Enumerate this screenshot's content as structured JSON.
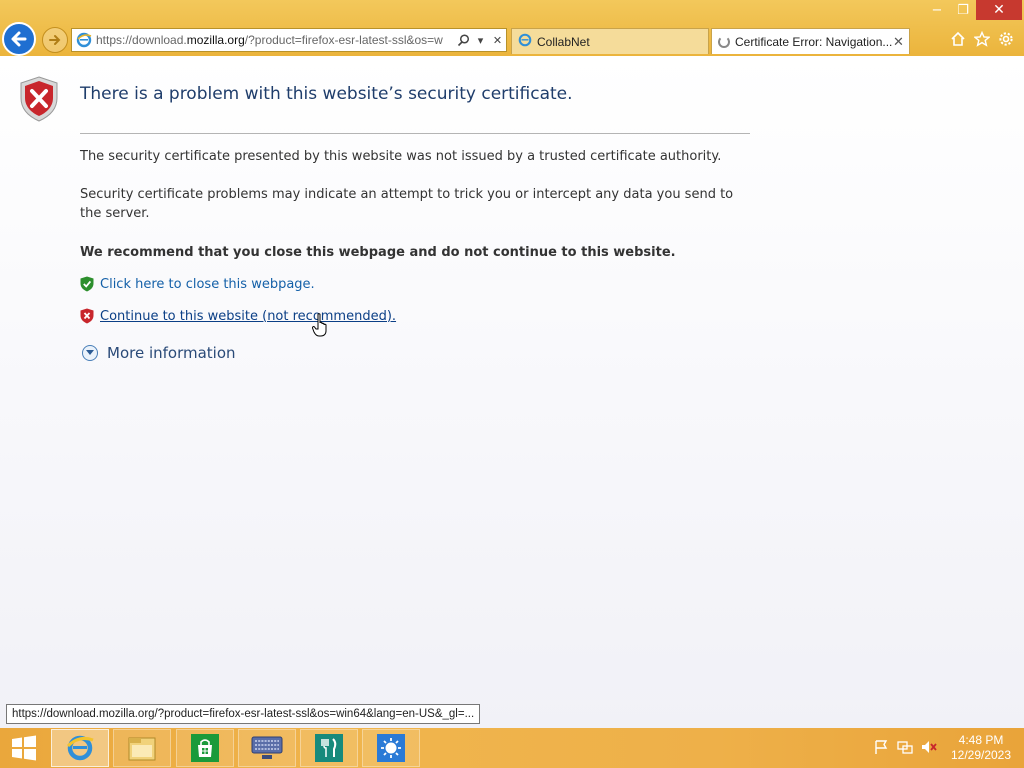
{
  "window": {
    "minimize_label": "−",
    "restore_label": "❐",
    "close_label": "✕"
  },
  "address_bar": {
    "url_prefix": "https://download.",
    "url_domain": "mozilla.org",
    "url_suffix": "/?product=firefox-esr-latest-ssl&os=w"
  },
  "tabs": [
    {
      "label": "CollabNet",
      "active": false
    },
    {
      "label": "Certificate Error: Navigation...",
      "active": true,
      "close": "✕"
    }
  ],
  "page": {
    "title": "There is a problem with this website’s security certificate.",
    "paragraph1": "The security certificate presented by this website was not issued by a trusted certificate authority.",
    "paragraph2": "Security certificate problems may indicate an attempt to trick you or intercept any data you send to the server.",
    "recommendation": "We recommend that you close this webpage and do not continue to this website.",
    "close_link": "Click here to close this webpage.",
    "continue_link": "Continue to this website (not recommended).",
    "more_info": "More information"
  },
  "status_tooltip": "https://download.mozilla.org/?product=firefox-esr-latest-ssl&os=win64&lang=en-US&_gl=...",
  "taskbar": {
    "pinned": [
      "internet-explorer",
      "file-explorer",
      "store",
      "keyboard-app",
      "food-app",
      "weather-app"
    ],
    "time": "4:48 PM",
    "date": "12/29/2023"
  },
  "colors": {
    "chrome": "#f0c050",
    "link": "#1460a8",
    "title": "#1f3d6b",
    "taskbar": "#eeb049"
  }
}
